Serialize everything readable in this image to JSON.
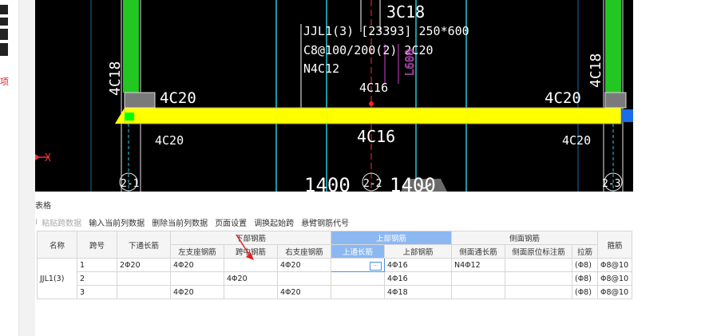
{
  "left_panel": {
    "label": "项"
  },
  "canvas": {
    "bg_color": "#000000",
    "beam_color": "#ffff00",
    "column_color": "#22c722",
    "beam_annotation": [
      "JJL1(3) [23393] 250*600",
      "C8@100/200(2) 2C20",
      "N4C12"
    ],
    "labels": {
      "top_3c18": "3C18",
      "left_col_4c18": "4C18",
      "right_col_4c18": "4C18",
      "left_top_4c20": "4C20",
      "right_top_4c20": "4C20",
      "mid_top_4c16": "4C16",
      "mid_bottom_4c16": "4C16",
      "left_bottom_4c20": "4C20",
      "right_bottom_4c20": "4C20",
      "l600": "L600",
      "x_axis": "X",
      "grid_2_1": "2-1",
      "grid_2_2": "2-2",
      "grid_2_3": "2-3",
      "dim_1400_a": "1400",
      "dim_1400_b": "1400"
    }
  },
  "panel": {
    "title": "表格",
    "toolbar": [
      "粘贴跨数据",
      "输入当前列数据",
      "删除当前列数据",
      "页面设置",
      "调换起始跨",
      "悬臂钢筋代号"
    ]
  },
  "table": {
    "headers": {
      "name": "名称",
      "span": "跨号",
      "bottom_through": "下通长筋",
      "bottom_group": "下部钢筋",
      "top_group": "上部钢筋",
      "side_group": "侧面钢筋",
      "stirrup": "箍筋"
    },
    "sub_headers": [
      "左支座钢筋",
      "跨中钢筋",
      "右支座钢筋",
      "上通长筋",
      "上部钢筋",
      "侧面通长筋",
      "侧面原位标注筋",
      "拉筋"
    ],
    "member_name": "JJL1(3)",
    "rows": [
      {
        "span": "1",
        "bottom_through": "2Φ20",
        "left_support": "4Φ20",
        "mid": "",
        "right_support": "4Φ20",
        "top_through": "",
        "top": "4Φ16",
        "side_through": "N4Φ12",
        "side_local": "",
        "tie": "(Φ8)",
        "stirrup": "Φ8@10"
      },
      {
        "span": "2",
        "bottom_through": "",
        "left_support": "",
        "mid": "4Φ20",
        "right_support": "",
        "top_through": "",
        "top": "4Φ16",
        "side_through": "",
        "side_local": "",
        "tie": "(Φ8)",
        "stirrup": "Φ8@10"
      },
      {
        "span": "3",
        "bottom_through": "",
        "left_support": "4Φ20",
        "mid": "",
        "right_support": "4Φ20",
        "top_through": "",
        "top": "4Φ18",
        "side_through": "",
        "side_local": "",
        "tie": "(Φ8)",
        "stirrup": "Φ8@10"
      }
    ]
  }
}
